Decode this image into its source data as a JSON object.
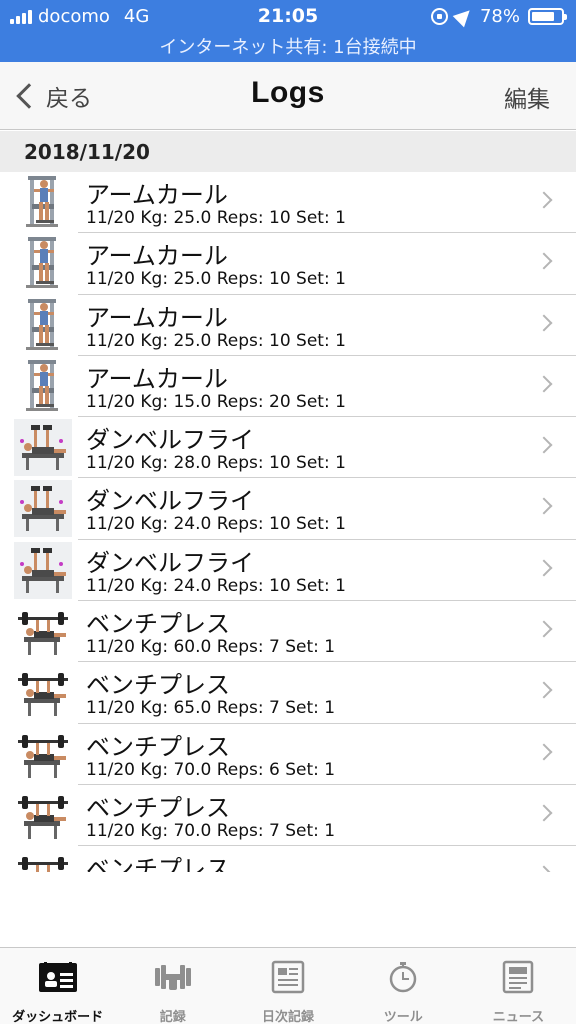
{
  "status_bar": {
    "carrier": "docomo",
    "network": "4G",
    "time": "21:05",
    "battery": "78%",
    "battery_level": 0.78,
    "tethering": "インターネット共有: 1台接続中"
  },
  "nav": {
    "back_label": "戻る",
    "title": "Logs",
    "edit_label": "編集"
  },
  "section": {
    "date": "2018/11/20"
  },
  "logs": [
    {
      "name": "アームカール",
      "detail": "11/20  Kg: 25.0  Reps: 10  Set: 1",
      "thumb": "arm-curl"
    },
    {
      "name": "アームカール",
      "detail": "11/20  Kg: 25.0  Reps: 10  Set: 1",
      "thumb": "arm-curl"
    },
    {
      "name": "アームカール",
      "detail": "11/20  Kg: 25.0  Reps: 10  Set: 1",
      "thumb": "arm-curl"
    },
    {
      "name": "アームカール",
      "detail": "11/20  Kg: 15.0  Reps: 20  Set: 1",
      "thumb": "arm-curl"
    },
    {
      "name": "ダンベルフライ",
      "detail": "11/20  Kg: 28.0  Reps: 10  Set: 1",
      "thumb": "dumbbell-fly"
    },
    {
      "name": "ダンベルフライ",
      "detail": "11/20  Kg: 24.0  Reps: 10  Set: 1",
      "thumb": "dumbbell-fly"
    },
    {
      "name": "ダンベルフライ",
      "detail": "11/20  Kg: 24.0  Reps: 10  Set: 1",
      "thumb": "dumbbell-fly"
    },
    {
      "name": "ベンチプレス",
      "detail": "11/20  Kg: 60.0  Reps: 7  Set: 1",
      "thumb": "bench-press"
    },
    {
      "name": "ベンチプレス",
      "detail": "11/20  Kg: 65.0  Reps: 7  Set: 1",
      "thumb": "bench-press"
    },
    {
      "name": "ベンチプレス",
      "detail": "11/20  Kg: 70.0  Reps: 6  Set: 1",
      "thumb": "bench-press"
    },
    {
      "name": "ベンチプレス",
      "detail": "11/20  Kg: 70.0  Reps: 7  Set: 1",
      "thumb": "bench-press"
    },
    {
      "name": "ベンチプレス",
      "detail": "",
      "thumb": "bench-press"
    }
  ],
  "tabs": [
    {
      "label": "ダッシュボード",
      "icon": "dashboard-icon",
      "active": true
    },
    {
      "label": "記録",
      "icon": "dumbbell-icon",
      "active": false
    },
    {
      "label": "日次記録",
      "icon": "daily-log-icon",
      "active": false
    },
    {
      "label": "ツール",
      "icon": "stopwatch-icon",
      "active": false
    },
    {
      "label": "ニュース",
      "icon": "news-icon",
      "active": false
    }
  ],
  "colors": {
    "status_bar": "#3d7ee0",
    "active_tab": "#111111",
    "inactive_tab": "#8f8f8f"
  }
}
